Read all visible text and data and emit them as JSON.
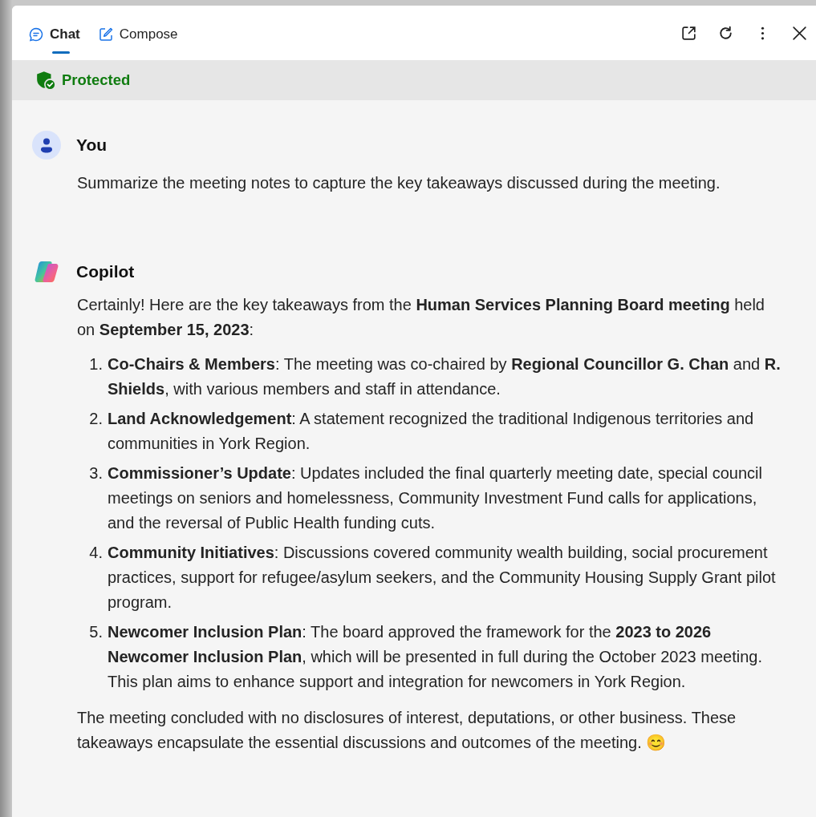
{
  "tabs": [
    {
      "label": "Chat",
      "selected": true
    },
    {
      "label": "Compose",
      "selected": false
    }
  ],
  "banner": {
    "label": "Protected"
  },
  "messages": [
    {
      "kind": "user",
      "author": "You",
      "paragraphs": [
        "Summarize the meeting notes to capture the key takeaways discussed during the meeting."
      ]
    },
    {
      "kind": "copilot",
      "author": "Copilot",
      "intro": "Certainly! Here are the key takeaways from the **Human Services Planning Board meeting** held on **September 15, 2023**:",
      "list": [
        {
          "number": "1.",
          "text": "**Co-Chairs & Members**: The meeting was co-chaired by **Regional Councillor G. Chan** and **R. Shields**, with various members and staff in attendance."
        },
        {
          "number": "2.",
          "text": "**Land Acknowledgement**: A statement recognized the traditional Indigenous territories and communities in York Region."
        },
        {
          "number": "3.",
          "text": "**Commissioner’s Update**: Updates included the final quarterly meeting date, special council meetings on seniors and homelessness, Community Investment Fund calls for applications, and the reversal of Public Health funding cuts."
        },
        {
          "number": "4.",
          "text": "**Community Initiatives**: Discussions covered community wealth building, social procurement practices, support for refugee/asylum seekers, and the Community Housing Supply Grant pilot program."
        },
        {
          "number": "5.",
          "text": "**Newcomer Inclusion Plan**: The board approved the framework for the **2023 to 2026 Newcomer Inclusion Plan**, which will be presented in full during the October 2023 meeting. This plan aims to enhance support and integration for newcomers in York Region."
        }
      ],
      "paragraphs": [
        "The meeting concluded with no disclosures of interest, deputations, or other business. These takeaways encapsulate the essential discussions and outcomes of the meeting. 😊"
      ]
    }
  ]
}
